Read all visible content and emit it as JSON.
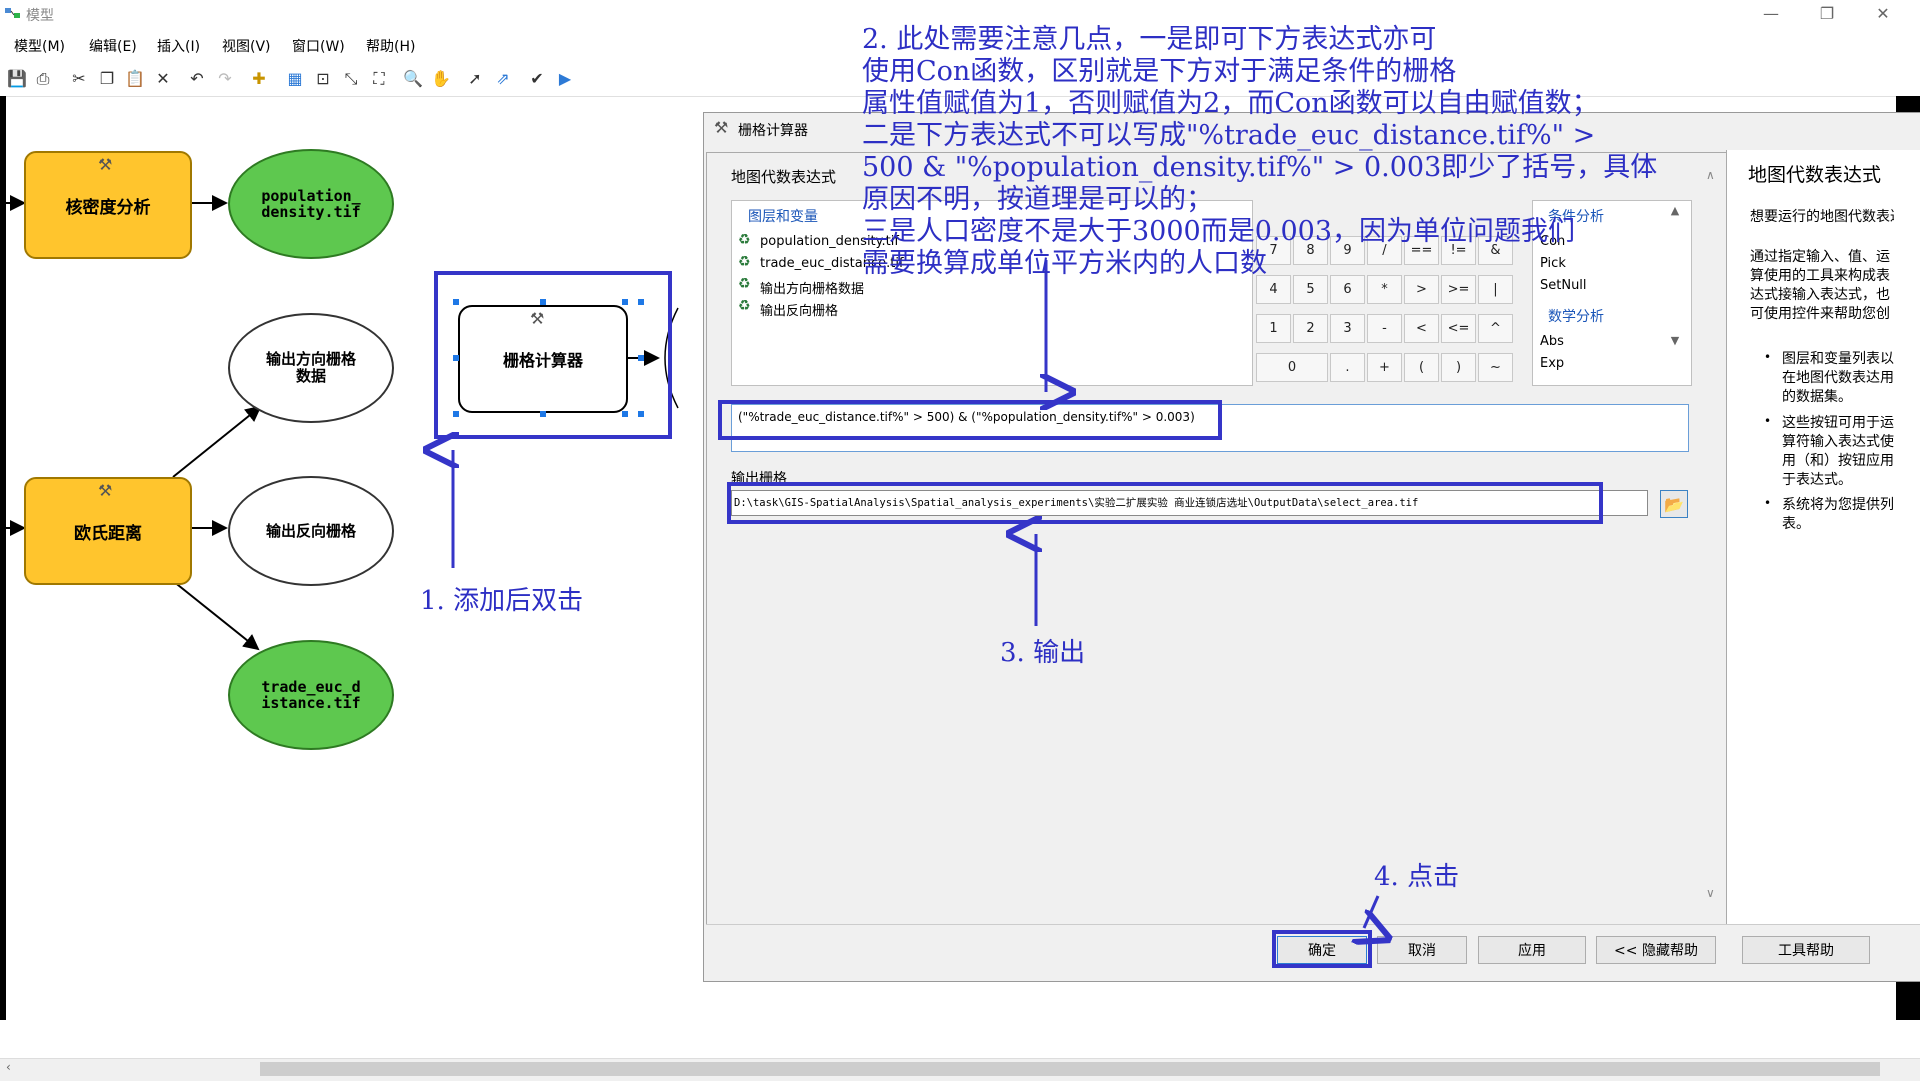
{
  "window": {
    "title": "模型",
    "minimize": "—",
    "restore": "❐",
    "close": "✕"
  },
  "menu": [
    "模型(M)",
    "编辑(E)",
    "插入(I)",
    "视图(V)",
    "窗口(W)",
    "帮助(H)"
  ],
  "toolbar_icons": [
    "save-icon",
    "print-icon",
    "cut-icon",
    "copy-icon",
    "paste-icon",
    "delete-icon",
    "undo-icon",
    "redo-icon",
    "add-data-icon",
    "auto-layout-icon",
    "full-extent-icon",
    "zoom-out-icon",
    "fit-icon",
    "zoom-in-icon",
    "pan-icon",
    "select-icon",
    "connect-icon",
    "validate-icon",
    "run-icon"
  ],
  "model": {
    "proc_kernel": "核密度分析",
    "out_pop": "population_\ndensity.tif",
    "out_dir": "输出方向栅格\n数据",
    "proc_euc": "欧氏距离",
    "out_back": "输出反向栅格",
    "out_trade": "trade_euc_d\nistance.tif",
    "proc_calc": "栅格计算器"
  },
  "dialog": {
    "title": "栅格计算器",
    "expr_section": "地图代数表达式",
    "layers_header": "图层和变量",
    "layers": [
      "population_density.tif",
      "trade_euc_distance.tif",
      "输出方向栅格数据",
      "输出反向栅格"
    ],
    "calc_buttons": [
      "7",
      "8",
      "9",
      "/",
      "==",
      "!=",
      "&",
      "4",
      "5",
      "6",
      "*",
      ">",
      ">=",
      "|",
      "1",
      "2",
      "3",
      "-",
      "<",
      "<=",
      "^",
      "0",
      ".",
      "+",
      "(",
      ")",
      "~"
    ],
    "cond_header": "条件分析",
    "cond_funcs": [
      "Con",
      "Pick",
      "SetNull"
    ],
    "math_header": "数学分析",
    "math_funcs": [
      "Abs",
      "Exp"
    ],
    "expression": "(\"%trade_euc_distance.tif%\" > 500) & (\"%population_density.tif%\" > 0.003)",
    "output_label": "输出栅格",
    "output_path": "D:\\task\\GIS-SpatialAnalysis\\Spatial_analysis_experiments\\实验二扩展实验 商业连锁店选址\\OutputData\\select_area.tif",
    "buttons": {
      "ok": "确定",
      "cancel": "取消",
      "apply": "应用",
      "hide_help": "<< 隐藏帮助",
      "tool_help": "工具帮助"
    }
  },
  "help": {
    "title": "地图代数表达式",
    "intro": "想要运行的地图代数表达",
    "para": "通过指定输入、值、运算使用的工具来构成表达式接输入表达式，也可使用控件来帮助您创建表达式",
    "bullet1": "图层和变量列表以在地图代数表达用的数据集。",
    "bullet2": "这些按钮可用于运算符输入表达式使用（和）按钮应用于表达式。",
    "bullet3": "系统将为您提供列表。"
  },
  "annotations": {
    "note2_lines": [
      "2. 此处需要注意几点，一是即可下方表达式亦可",
      "使用Con函数，区别就是下方对于满足条件的栅格",
      "属性值赋值为1，否则赋值为2，而Con函数可以自由赋值数；",
      "二是下方表达式不可以写成\"%trade_euc_distance.tif%\" >",
      "500 & \"%population_density.tif%\" > 0.003即少了括号，具体",
      "原因不明，按道理是可以的；",
      "三是人口密度不是大于3000而是0.003，因为单位问题我们",
      "需要换算成单位平方米内的人口数"
    ],
    "note1": "1. 添加后双击",
    "note3": "3. 输出",
    "note4": "4. 点击"
  }
}
